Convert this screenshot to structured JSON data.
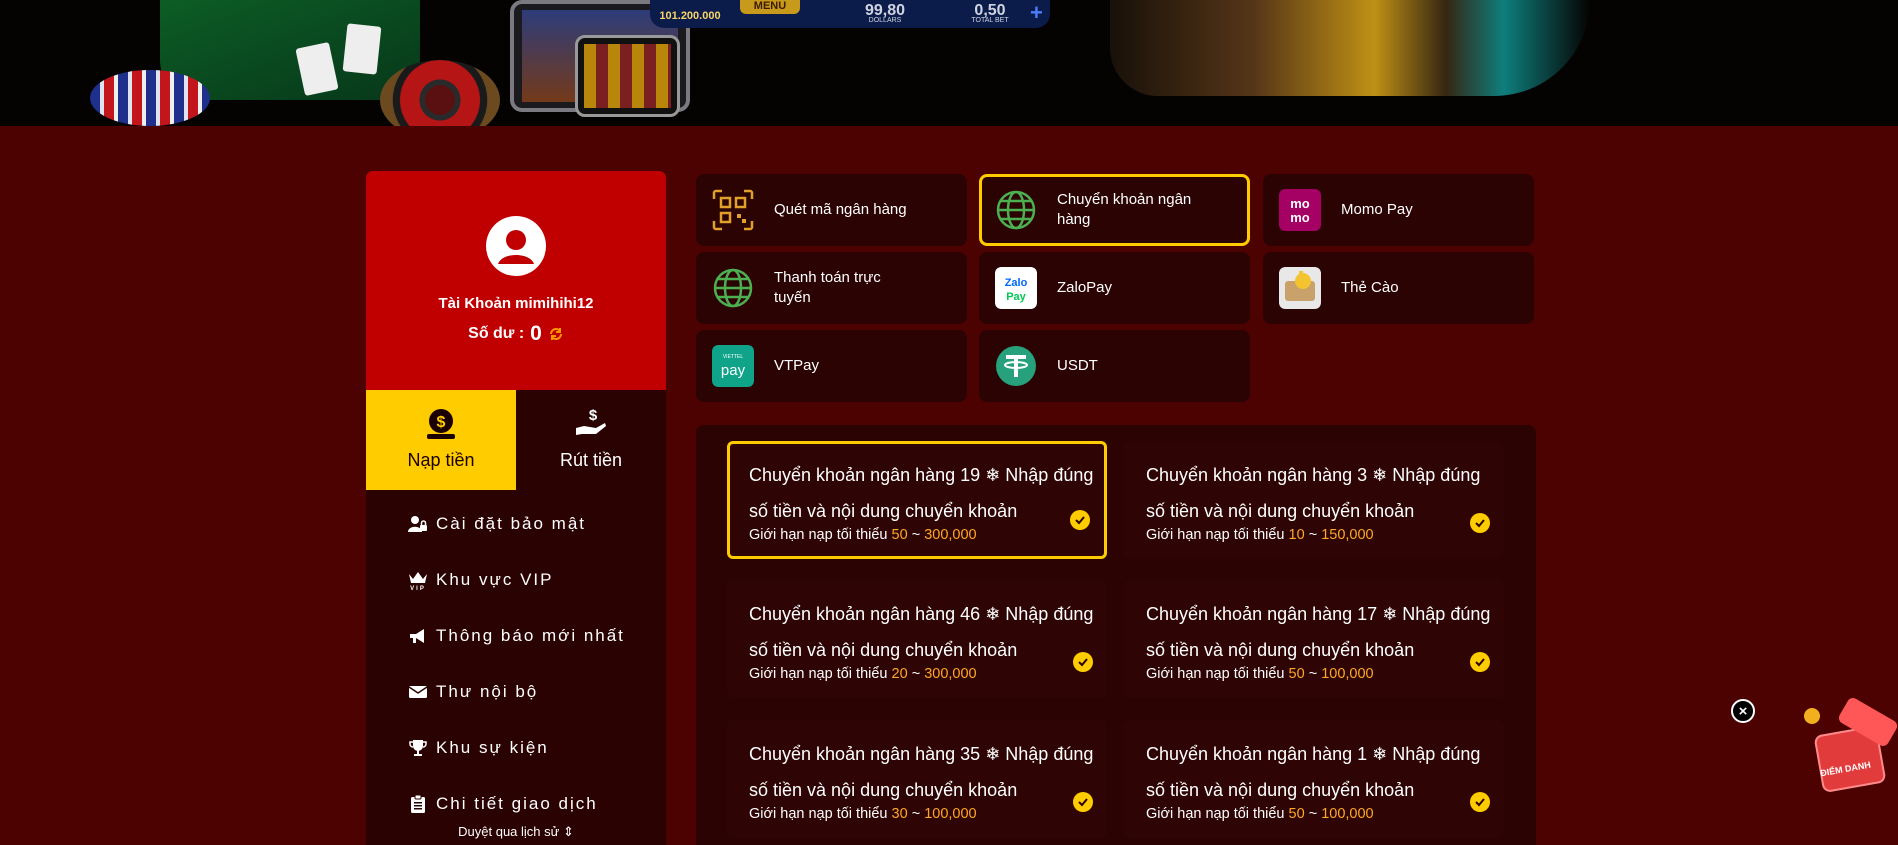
{
  "banner": {
    "amount": "101.200.000",
    "menu": "MENU",
    "dollars_value": "99,80",
    "dollars_label": "DOLLARS",
    "total_bet_value": "0,50",
    "total_bet_label": "TOTAL BET"
  },
  "profile": {
    "account": "Tài Khoản mimihihi12",
    "balance_label": "Số dư :",
    "balance_value": "0"
  },
  "tabs": [
    {
      "label": "Nạp tiền",
      "icon": "money-bag-icon",
      "active": true
    },
    {
      "label": "Rút tiền",
      "icon": "hand-dollar-icon",
      "active": false
    }
  ],
  "menu": [
    {
      "label": "Cài đặt bảo mật",
      "icon": "user-lock-icon"
    },
    {
      "label": "Khu vực VIP",
      "icon": "crown-vip-icon"
    },
    {
      "label": "Thông báo mới nhất",
      "icon": "megaphone-icon"
    },
    {
      "label": "Thư nội bộ",
      "icon": "envelope-icon"
    },
    {
      "label": "Khu sự kiện",
      "icon": "trophy-icon"
    },
    {
      "label": "Chi tiết giao dịch",
      "icon": "clipboard-icon"
    }
  ],
  "history_link": "Duyệt qua lịch sử ⇕",
  "methods": [
    {
      "label": "Quét mã ngân hàng",
      "icon": "qr-code-icon",
      "active": false
    },
    {
      "label": "Chuyển khoản ngân hàng",
      "icon": "globe-icon",
      "active": true
    },
    {
      "label": "Momo Pay",
      "icon": "momo-icon",
      "active": false
    },
    {
      "label": "Thanh toán trực tuyến",
      "icon": "globe-icon",
      "active": false
    },
    {
      "label": "ZaloPay",
      "icon": "zalopay-icon",
      "active": false
    },
    {
      "label": "Thẻ Cào",
      "icon": "scratch-card-icon",
      "active": false
    },
    {
      "label": "VTPay",
      "icon": "vtpay-icon",
      "active": false
    },
    {
      "label": "USDT",
      "icon": "tether-icon",
      "active": false
    }
  ],
  "banks": [
    {
      "name": "Chuyển khoản ngân hàng 19 ❄ Nhập đúng số tiền và nội dung chuyển khoản",
      "limit_label": "Giới hạn nạp tối thiểu",
      "min": "50",
      "sep": "~",
      "max": "300,000",
      "active": true
    },
    {
      "name": "Chuyển khoản ngân hàng 3 ❄ Nhập đúng số tiền và nội dung chuyển khoản",
      "limit_label": "Giới hạn nạp tối thiểu",
      "min": "10",
      "sep": "~",
      "max": "150,000",
      "active": false
    },
    {
      "name": "Chuyển khoản ngân hàng 46 ❄ Nhập đúng số tiền và nội dung chuyển khoản",
      "limit_label": "Giới hạn nạp tối thiểu",
      "min": "20",
      "sep": "~",
      "max": "300,000",
      "active": false
    },
    {
      "name": "Chuyển khoản ngân hàng 17 ❄ Nhập đúng số tiền và nội dung chuyển khoản",
      "limit_label": "Giới hạn nạp tối thiểu",
      "min": "50",
      "sep": "~",
      "max": "100,000",
      "active": false
    },
    {
      "name": "Chuyển khoản ngân hàng 35 ❄ Nhập đúng số tiền và nội dung chuyển khoản",
      "limit_label": "Giới hạn nạp tối thiểu",
      "min": "30",
      "sep": "~",
      "max": "100,000",
      "active": false
    },
    {
      "name": "Chuyển khoản ngân hàng 1 ❄ Nhập đúng số tiền và nội dung chuyển khoản",
      "limit_label": "Giới hạn nạp tối thiểu",
      "min": "50",
      "sep": "~",
      "max": "100,000",
      "active": false
    }
  ],
  "float": {
    "close": "×",
    "gift_label": "ĐIỂM DANH"
  },
  "colors": {
    "page_bg": "#4d0202",
    "accent": "#ffcc00",
    "profile_bg": "#c00000",
    "panel_bg": "#2b0303",
    "limit_number": "#ffa726"
  }
}
